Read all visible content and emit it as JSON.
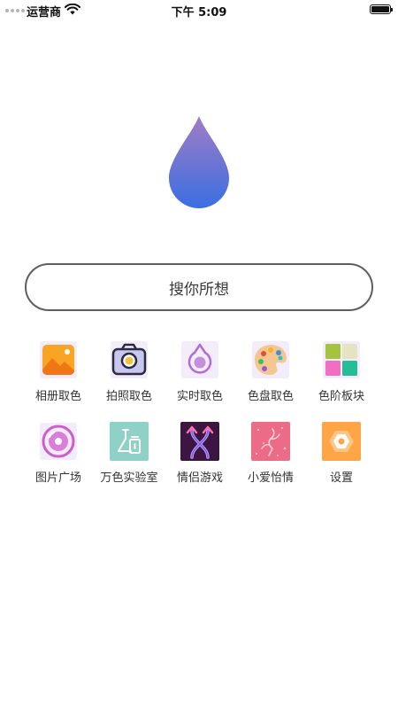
{
  "status_bar": {
    "carrier": "运营商",
    "time": "下午 5:09"
  },
  "search": {
    "placeholder": "搜你所想"
  },
  "features": [
    {
      "label": "相册取色",
      "icon": "photo-album-icon"
    },
    {
      "label": "拍照取色",
      "icon": "camera-icon"
    },
    {
      "label": "实时取色",
      "icon": "live-pick-icon"
    },
    {
      "label": "色盘取色",
      "icon": "palette-icon"
    },
    {
      "label": "色阶板块",
      "icon": "color-blocks-icon"
    },
    {
      "label": "图片广场",
      "icon": "disc-icon"
    },
    {
      "label": "万色实验室",
      "icon": "flask-icon"
    },
    {
      "label": "情侣游戏",
      "icon": "crossing-arrows-icon"
    },
    {
      "label": "小爱怡情",
      "icon": "pink-pattern-icon"
    },
    {
      "label": "设置",
      "icon": "settings-hexagon-icon"
    }
  ],
  "colors": {
    "drop_top": "#9a78c8",
    "drop_bottom": "#3d6fe0",
    "search_border": "#5e5e5e"
  }
}
